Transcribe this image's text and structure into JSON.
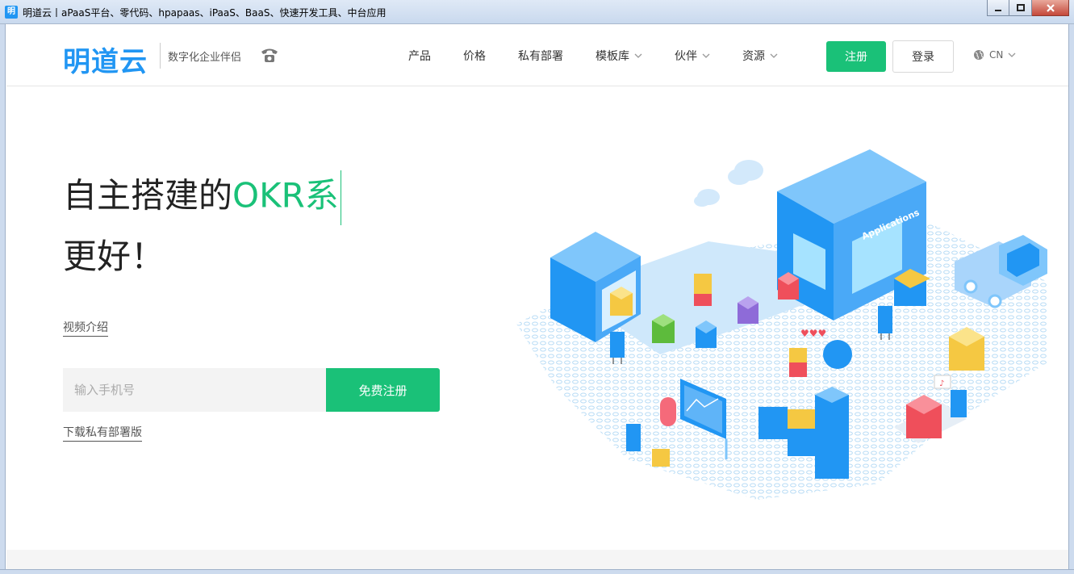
{
  "window": {
    "title": "明道云丨aPaaS平台、零代码、hpapaas、iPaaS、BaaS、快速开发工具、中台应用",
    "app_icon_glyph": "明"
  },
  "nav": {
    "logo": "明道云",
    "tagline": "数字化企业伴侣",
    "phone_icon": "phone-icon",
    "links": [
      {
        "label": "产品"
      },
      {
        "label": "价格"
      },
      {
        "label": "私有部署"
      },
      {
        "label": "模板库"
      },
      {
        "label": "伙伴"
      },
      {
        "label": "资源"
      }
    ],
    "register_label": "注册",
    "login_label": "登录",
    "lang_label": "CN"
  },
  "hero": {
    "title_plain": "自主搭建的",
    "title_accent": "OKR系",
    "title_line2": "更好！",
    "video_link": "视频介绍",
    "phone_placeholder": "输入手机号",
    "free_register": "免费注册",
    "download_link": "下载私有部署版"
  },
  "illustration": {
    "sign_text": "Applications"
  },
  "colors": {
    "brand_blue": "#2196f3",
    "accent_green": "#1ac178"
  }
}
